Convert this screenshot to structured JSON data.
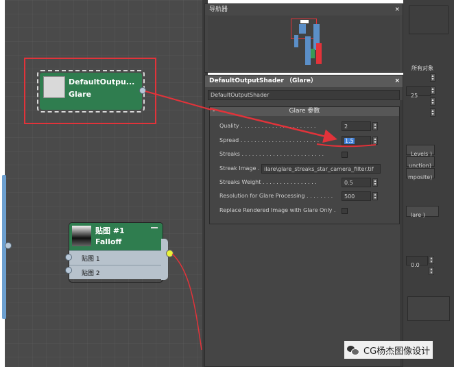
{
  "node_editor": {
    "output_node": {
      "title": "DefaultOutpu...",
      "subtitle": "Glare"
    },
    "falloff_node": {
      "title": "贴图 #1",
      "subtitle": "Falloff",
      "inputs": [
        "贴图 1",
        "贴图 2"
      ]
    }
  },
  "navigator": {
    "title": "导航器",
    "close": "×"
  },
  "shader_panel": {
    "title": "DefaultOutputShader （Glare）",
    "close": "×",
    "name_value": "DefaultOutputShader",
    "rollout_toggle": "-",
    "rollout_title": "Glare 参数",
    "params": [
      {
        "label": "Quality . . . . . . . . . . . . . . . . . . . . . .",
        "value": "2"
      },
      {
        "label": "Spread . . . . . . . . . . . . . . . . . . . . . . .",
        "value": "1.5"
      }
    ],
    "streaks_label": "Streaks . . . . . . . . . . . . . . . . . . . . . . . .",
    "streak_image_label": "Streak Image .",
    "streak_image_value": "ilare\\glare_streaks_star_camera_filter.tif",
    "streaks_weight_label": "Streaks Weight . . . . . . . . . . . . . . . .",
    "streaks_weight_value": "0.5",
    "resolution_label": "Resolution for Glare Processing . . . . . . . .",
    "resolution_value": "500",
    "replace_label": "Replace Rendered Image with Glare Only ."
  },
  "right_fragments": {
    "top": "所有对象",
    "num": "25",
    "levels": "Levels )",
    "junction": "unction)",
    "composite": "mposite)",
    "glare": "lare )",
    "zero": "0.0"
  },
  "watermark": {
    "text": "CG杨杰图像设计"
  },
  "colors": {
    "canvas": "#4a4a4a",
    "node_green": "#2f7d4f",
    "highlight_red": "#e2333a",
    "selection_blue": "#3f7fd8"
  }
}
